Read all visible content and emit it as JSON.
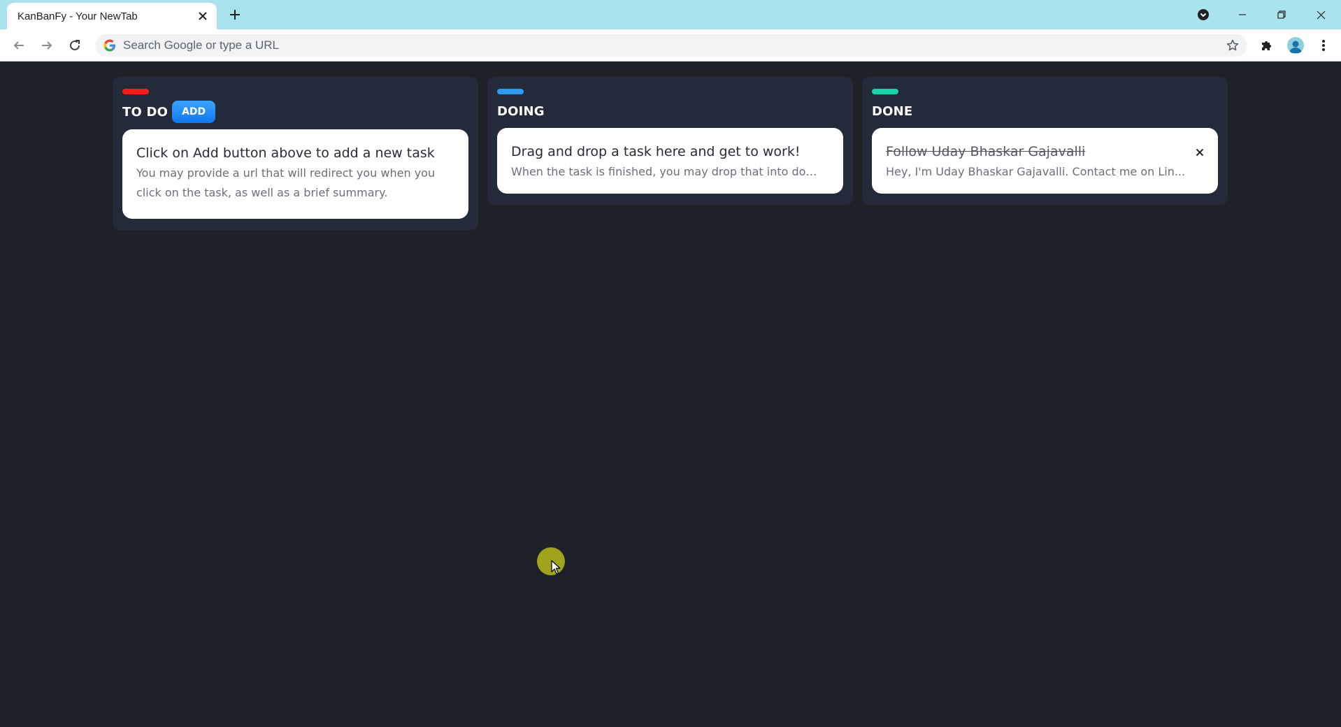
{
  "browser": {
    "tab_title": "KanBanFy - Your NewTab",
    "omnibox_placeholder": "Search Google or type a URL"
  },
  "board": {
    "columns": [
      {
        "title": "TO DO",
        "accent": "#ff1a1a",
        "add_label": "ADD",
        "cards": [
          {
            "title": "Click on Add button above to add a new task",
            "description": "You may provide a url that will redirect you when you click on the task, as well as a brief summary."
          }
        ]
      },
      {
        "title": "DOING",
        "accent": "#2f9bf0",
        "cards": [
          {
            "title": "Drag and drop a task here and get to work!",
            "description": "When the task is finished, you may drop that into done."
          }
        ]
      },
      {
        "title": "DONE",
        "accent": "#16d3a8",
        "cards": [
          {
            "title": "Follow Uday Bhaskar Gajavalli",
            "description": "Hey, I'm Uday Bhaskar Gajavalli. Contact me on Lin..."
          }
        ]
      }
    ]
  },
  "colors": {
    "background": "#1e2127",
    "column_bg": "#232b3b",
    "card_bg": "#ffffff",
    "add_button": "#1a86f5",
    "tabstrip": "#a9e4ee"
  }
}
